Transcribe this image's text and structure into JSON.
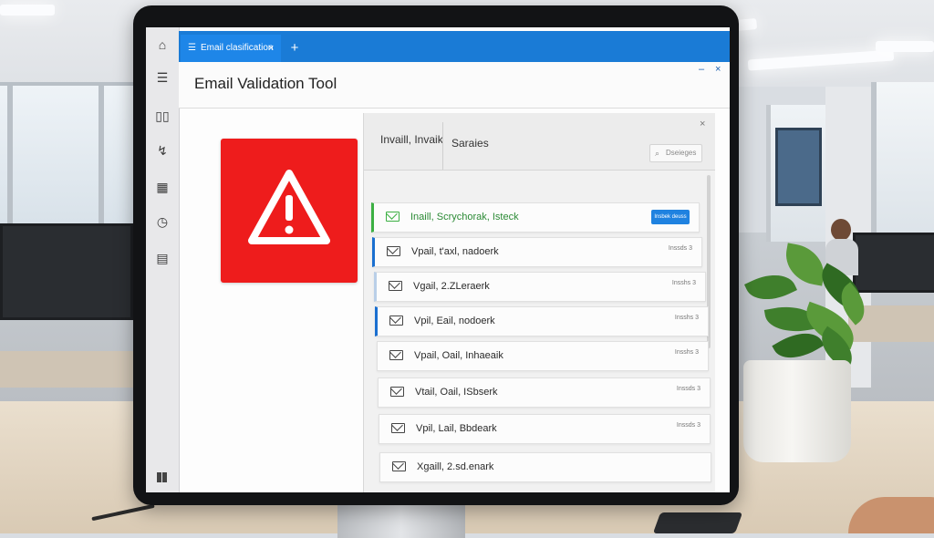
{
  "tab": {
    "label": "Email clasification",
    "menu_icon": "☰",
    "close": "×",
    "new_tab": "+"
  },
  "window": {
    "title": "Email Validation Tool",
    "minimize": "–",
    "close": "×"
  },
  "rail": {
    "icons": [
      "⌂",
      "☰",
      "▯▯",
      "↯",
      "▦",
      "◷",
      "▤"
    ]
  },
  "panel": {
    "tab1": "Invaill, Invaik",
    "tab2": "Saraies",
    "close": "×",
    "search_placeholder": "Dseieges",
    "search_icon": "⌕"
  },
  "rows": [
    {
      "text": "Inaill, Scrychorak, Isteck",
      "badge": "Insbek deuss",
      "status": "valid"
    },
    {
      "text": "Vpail, t'axl, nadoerk",
      "badge": "Inssds 3",
      "status": "marked"
    },
    {
      "text": "Vgail, 2.ZLeraerk",
      "badge": "Insshs 3",
      "status": "default"
    },
    {
      "text": "Vpil, Eail, nodoerk",
      "badge": "Insshs 3",
      "status": "marked"
    },
    {
      "text": "Vpail, Oail, Inhaeaik",
      "badge": "Insshs 3",
      "status": "default"
    },
    {
      "text": "Vtail, Oail, ISbserk",
      "badge": "Inssds 3",
      "status": "default"
    },
    {
      "text": "Vpil, Lail, Bbdeark",
      "badge": "Inssds 3",
      "status": "default"
    },
    {
      "text": "Xgaill, 2.sd.enark",
      "badge": "",
      "status": "default"
    }
  ],
  "colors": {
    "accent": "#1a7bd6",
    "warning": "#ee1c1c",
    "valid": "#3cb043"
  }
}
